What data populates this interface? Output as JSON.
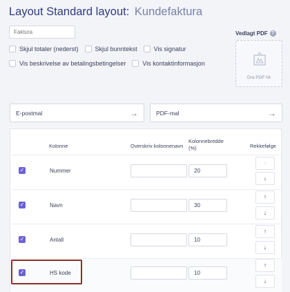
{
  "header": {
    "title_prefix": "Layout Standard layout:",
    "title_name": "Kundefaktura"
  },
  "document_title_input": {
    "placeholder": "Faktura",
    "value": ""
  },
  "options_row1": [
    {
      "label": "Skjul totaler (nederst)",
      "checked": false
    },
    {
      "label": "Skjul bunntekst",
      "checked": false
    },
    {
      "label": "Vis signatur",
      "checked": false
    }
  ],
  "options_row2": [
    {
      "label": "Vis beskrivelse av betalingsbetingelser",
      "checked": false
    },
    {
      "label": "Vis kontaktinformasjon",
      "checked": false
    }
  ],
  "attachment": {
    "label": "Vedlagt PDF",
    "drop_text": "Dra PDF hit",
    "help_icon": "question-icon",
    "drop_icon": "image-frame-icon"
  },
  "templates": {
    "email": {
      "label": "E-postmal",
      "icon": "arrow-right-icon",
      "arrow": "→"
    },
    "pdf": {
      "label": "PDF-mal",
      "icon": "arrow-right-icon",
      "arrow": "→"
    }
  },
  "table": {
    "headers": {
      "column": "Kolonne",
      "override": "Overskriv kolonnenavn",
      "width_line1": "Kolonnebredde",
      "width_line2": "(%)",
      "order": "Rekkefølge"
    },
    "rows": [
      {
        "checked": true,
        "name": "Nummer",
        "override": "",
        "width": "20",
        "up_enabled": false,
        "up": "↑",
        "down": "↓"
      },
      {
        "checked": true,
        "name": "Navn",
        "override": "",
        "width": "30",
        "up_enabled": true,
        "up": "↑",
        "down": "↓"
      },
      {
        "checked": true,
        "name": "Antall",
        "override": "",
        "width": "10",
        "up_enabled": true,
        "up": "↑",
        "down": "↓"
      },
      {
        "checked": true,
        "name": "HS kode",
        "override": "",
        "width": "10",
        "up_enabled": true,
        "up": "↑",
        "down": "↓",
        "highlighted": true
      }
    ],
    "check_glyph": "✓"
  },
  "colors": {
    "accent": "#6c62d6",
    "title": "#2e3a7e",
    "title_name": "#7b80a6",
    "highlight": "#8c2d2d",
    "background": "#f3f4f8"
  }
}
